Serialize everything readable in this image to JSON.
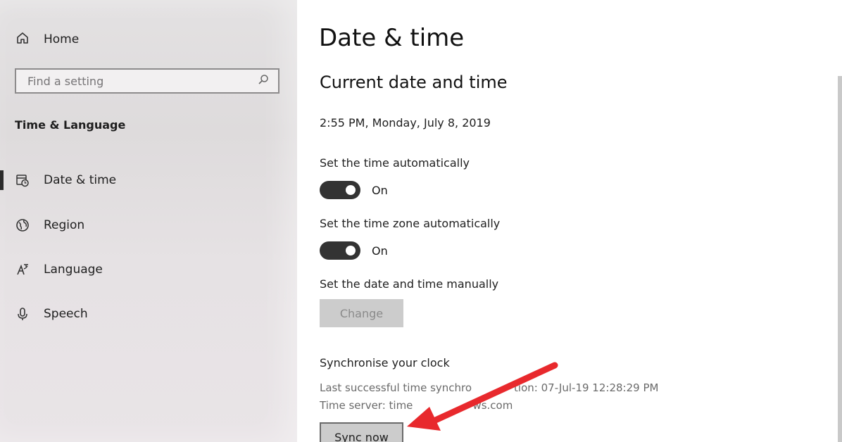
{
  "sidebar": {
    "home_label": "Home",
    "search_placeholder": "Find a setting",
    "section_title": "Time & Language",
    "items": [
      {
        "label": "Date & time",
        "icon": "date-time-icon"
      },
      {
        "label": "Region",
        "icon": "globe-icon"
      },
      {
        "label": "Language",
        "icon": "language-icon"
      },
      {
        "label": "Speech",
        "icon": "microphone-icon"
      }
    ]
  },
  "main": {
    "title": "Date & time",
    "subheading": "Current date and time",
    "current_datetime": "2:55 PM, Monday, July 8, 2019",
    "auto_time": {
      "label": "Set the time automatically",
      "state": "On"
    },
    "auto_timezone": {
      "label": "Set the time zone automatically",
      "state": "On"
    },
    "manual": {
      "label": "Set the date and time manually",
      "button": "Change"
    },
    "sync": {
      "heading": "Synchronise your clock",
      "last_sync_prefix": "Last successful time synchro",
      "last_sync_suffix": "tion: 07-Jul-19 12:28:29 PM",
      "server_prefix": "Time server: time",
      "server_suffix": "ws.com",
      "button": "Sync now"
    }
  },
  "colors": {
    "annotation_arrow": "#e8292d",
    "toggle_on": "#333333"
  }
}
